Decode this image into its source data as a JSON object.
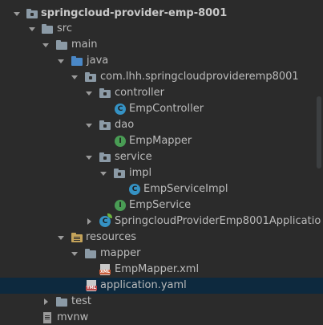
{
  "project_tree": {
    "root_label": "springcloud-provider-emp-8001",
    "src_label": "src",
    "main_label": "main",
    "java_label": "java",
    "package_label": "com.lhh.springcloudprovideremp8001",
    "controller_label": "controller",
    "emp_controller_label": "EmpController",
    "dao_label": "dao",
    "emp_mapper_label": "EmpMapper",
    "service_label": "service",
    "impl_label": "impl",
    "emp_service_impl_label": "EmpServiceImpl",
    "emp_service_label": "EmpService",
    "application_class_label": "SpringcloudProviderEmp8001Applicatio",
    "resources_label": "resources",
    "mapper_folder_label": "mapper",
    "emp_mapper_xml_label": "EmpMapper.xml",
    "application_yaml_label": "application.yaml",
    "test_label": "test",
    "mvnw_label": "mvnw",
    "xml_tag": "XML",
    "yml_tag": "YML",
    "class_badge": "C",
    "interface_badge": "I"
  },
  "colors": {
    "background": "#2b2b2b",
    "selected_row": "#0d293e",
    "folder": "#8b9aa6",
    "class_icon": "#3592c4",
    "interface_icon": "#499c54",
    "spring": "#6db33f"
  }
}
